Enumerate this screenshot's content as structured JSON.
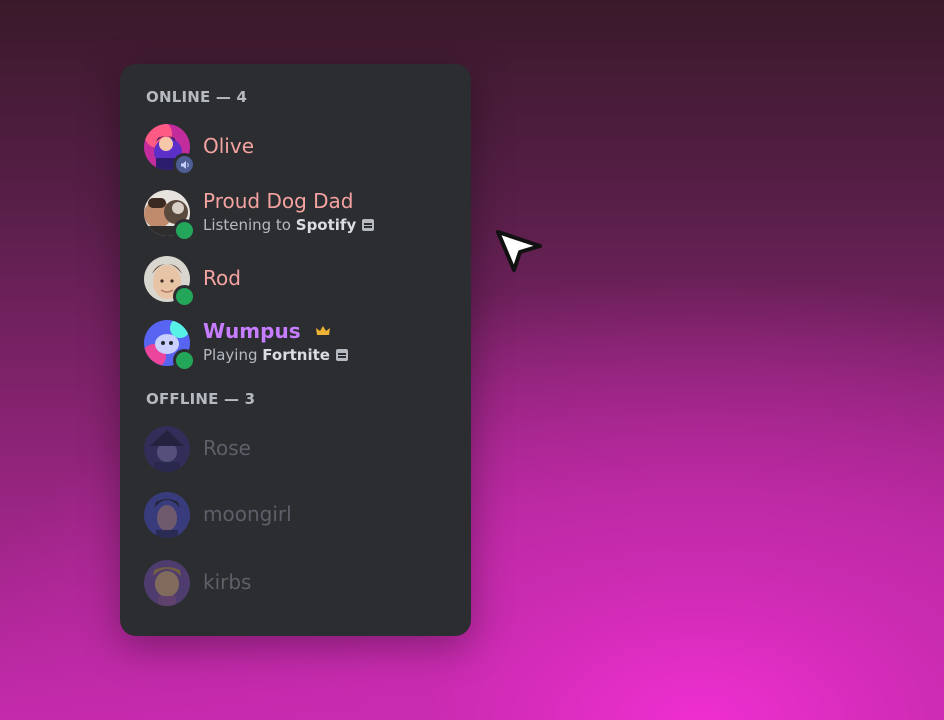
{
  "online": {
    "header": "ONLINE — 4",
    "members": [
      {
        "name": "Olive",
        "color": "#f5a3a0"
      },
      {
        "name": "Proud Dog Dad",
        "color": "#f5a3a0",
        "activity_prefix": "Listening to",
        "activity_name": "Spotify"
      },
      {
        "name": "Rod",
        "color": "#f5a3a0"
      },
      {
        "name": "Wumpus",
        "color": "#c77dff",
        "activity_prefix": "Playing",
        "activity_name": "Fortnite"
      }
    ]
  },
  "offline": {
    "header": "OFFLINE — 3",
    "members": [
      {
        "name": "Rose"
      },
      {
        "name": "moongirl"
      },
      {
        "name": "kirbs"
      }
    ]
  },
  "colors": {
    "panel": "#2b2d31",
    "online_status": "#23a55a",
    "role_color": "#f5a3a0",
    "owner_color": "#c77dff",
    "crown": "#f0b232"
  },
  "icons": [
    "speaker-icon",
    "rich-presence-icon",
    "crown-icon",
    "cursor-arrow-icon"
  ]
}
